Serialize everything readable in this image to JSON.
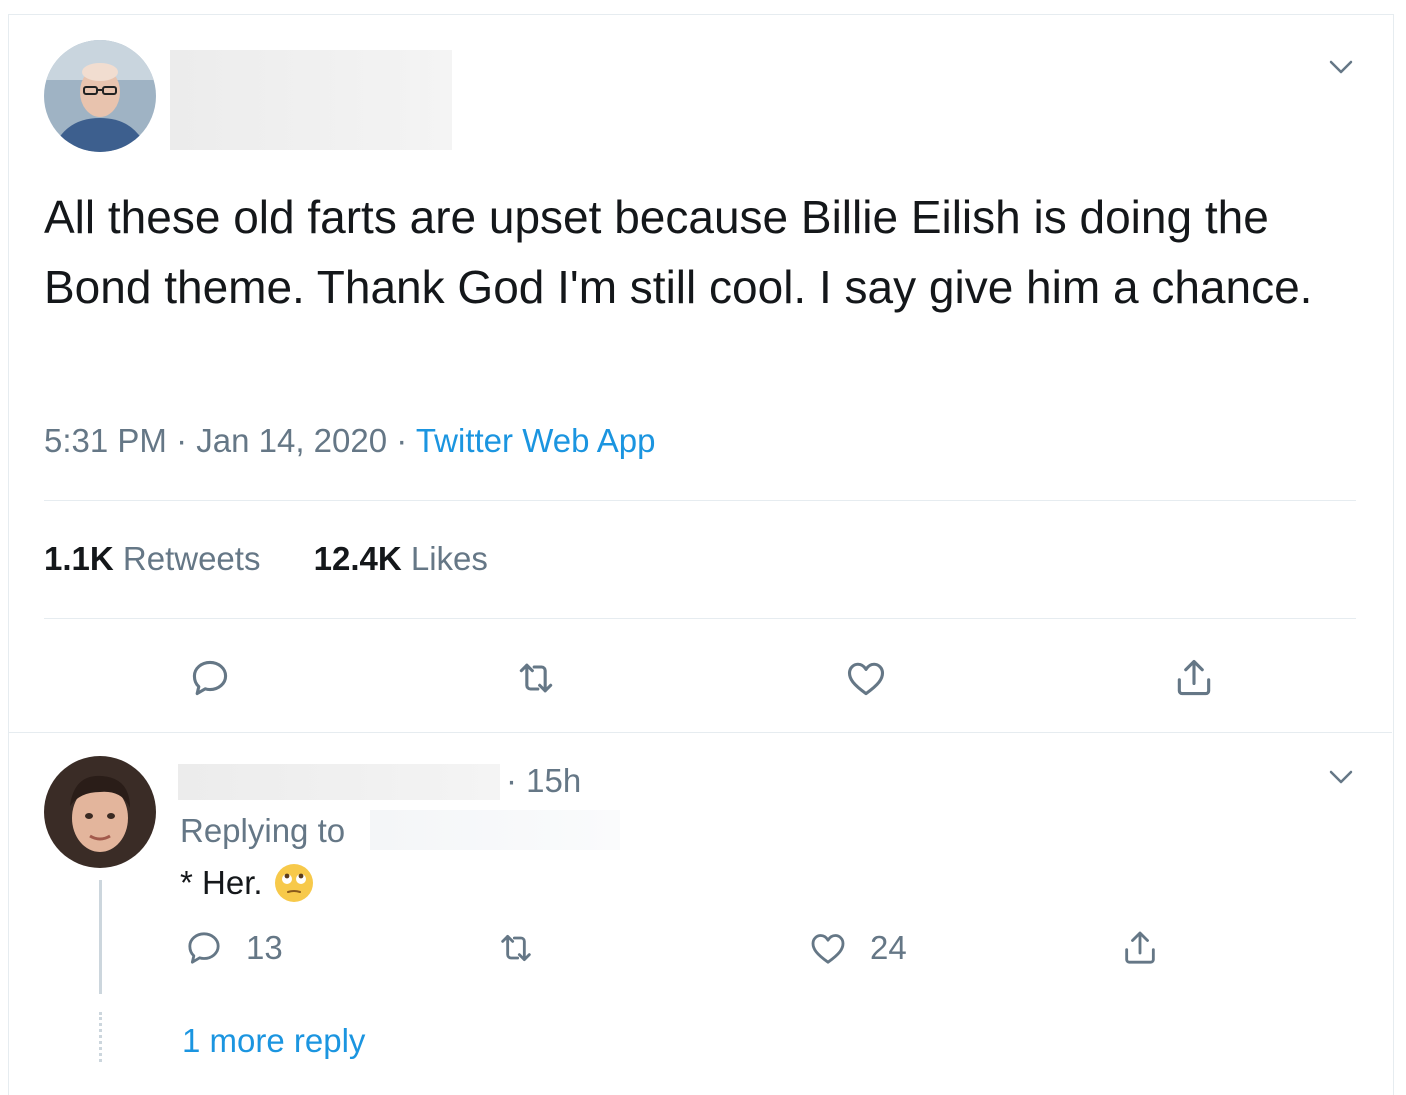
{
  "main_tweet": {
    "text": "All these old farts are upset because Billie Eilish is doing the Bond theme. Thank God I'm still cool. I say give him a chance.",
    "time": "5:31 PM",
    "date": "Jan 14, 2020",
    "source": "Twitter Web App",
    "separator": "·",
    "retweets_count": "1.1K",
    "retweets_label": "Retweets",
    "likes_count": "12.4K",
    "likes_label": "Likes"
  },
  "reply": {
    "age": "· 15h",
    "replying_to": "Replying to",
    "text": "* Her.",
    "reply_count": "13",
    "like_count": "24",
    "more_replies": "1 more reply"
  },
  "icons": {
    "menu": "chevron-down-icon",
    "reply": "reply-icon",
    "retweet": "retweet-icon",
    "like": "heart-icon",
    "share": "share-icon",
    "emoji": "eye-roll-emoji"
  },
  "colors": {
    "text": "#14171a",
    "secondary": "#657786",
    "link": "#1b95e0",
    "divider": "#e6ecf0"
  }
}
